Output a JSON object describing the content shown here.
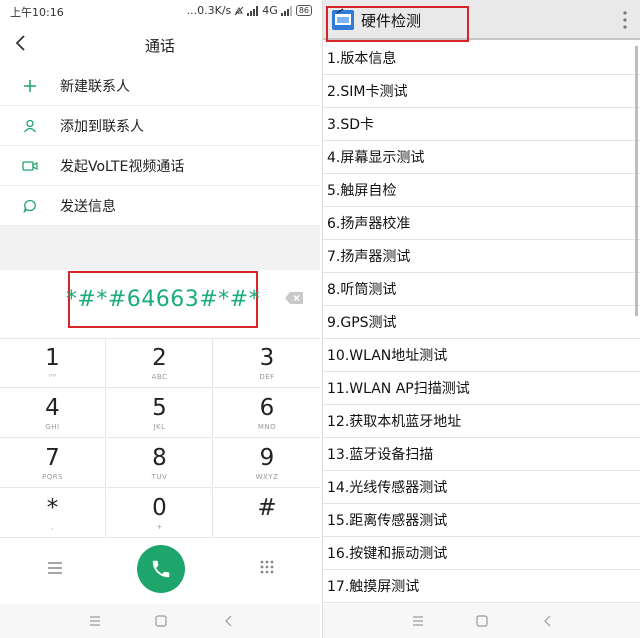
{
  "status_bar": {
    "time": "上午10:16",
    "net_speed": "...0.3K/s",
    "network": "4G",
    "battery": "86"
  },
  "dialer": {
    "title": "通话",
    "menu": [
      {
        "label": "新建联系人",
        "icon": "plus-icon"
      },
      {
        "label": "添加到联系人",
        "icon": "person-icon"
      },
      {
        "label": "发起VoLTE视频通话",
        "icon": "video-icon"
      },
      {
        "label": "发送信息",
        "icon": "message-icon"
      }
    ],
    "entered_number": "*#*#64663#*#*",
    "keys": [
      {
        "num": "1",
        "sub": "ᴼᴼ"
      },
      {
        "num": "2",
        "sub": "ABC"
      },
      {
        "num": "3",
        "sub": "DEF"
      },
      {
        "num": "4",
        "sub": "GHI"
      },
      {
        "num": "5",
        "sub": "JKL"
      },
      {
        "num": "6",
        "sub": "MNO"
      },
      {
        "num": "7",
        "sub": "PQRS"
      },
      {
        "num": "8",
        "sub": "TUV"
      },
      {
        "num": "9",
        "sub": "WXYZ"
      },
      {
        "num": "*",
        "sub": ","
      },
      {
        "num": "0",
        "sub": "+"
      },
      {
        "num": "#",
        "sub": ""
      }
    ]
  },
  "hardware_test": {
    "title": "硬件检测",
    "items": [
      "1.版本信息",
      "2.SIM卡测试",
      "3.SD卡",
      "4.屏幕显示测试",
      "5.触屏自检",
      "6.扬声器校准",
      "7.扬声器测试",
      "8.听筒测试",
      "9.GPS测试",
      "10.WLAN地址测试",
      "11.WLAN AP扫描测试",
      "12.获取本机蓝牙地址",
      "13.蓝牙设备扫描",
      "14.光线传感器测试",
      "15.距离传感器测试",
      "16.按键和振动测试",
      "17.触摸屏测试"
    ]
  },
  "colors": {
    "accent_green": "#1ea56b",
    "number_green": "#1aad7a",
    "highlight_red": "#d9232a"
  }
}
